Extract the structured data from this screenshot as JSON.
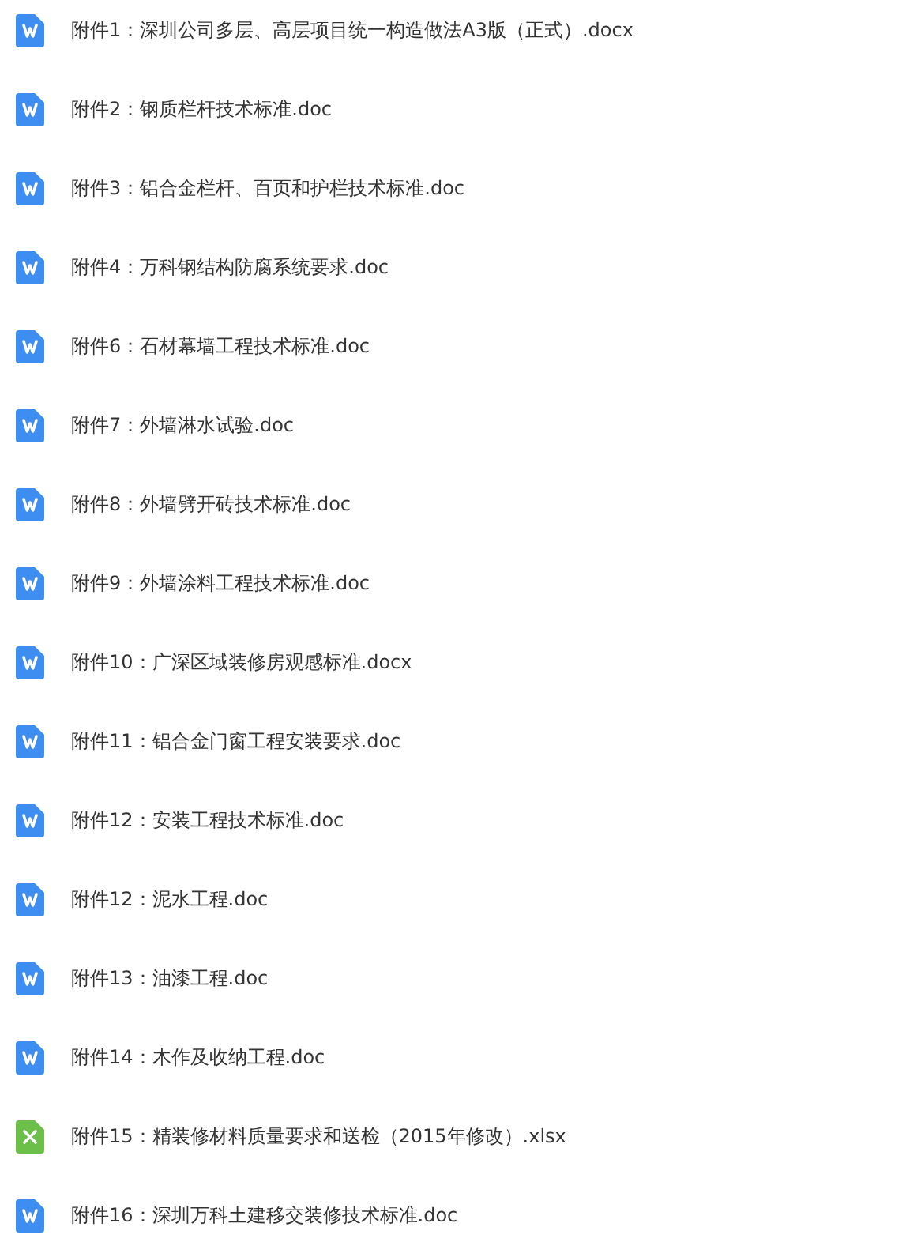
{
  "files": [
    {
      "kind": "word",
      "name": "附件1：深圳公司多层、高层项目统一构造做法A3版（正式）.docx"
    },
    {
      "kind": "word",
      "name": "附件2：钢质栏杆技术标准.doc"
    },
    {
      "kind": "word",
      "name": "附件3：铝合金栏杆、百页和护栏技术标准.doc"
    },
    {
      "kind": "word",
      "name": "附件4：万科钢结构防腐系统要求.doc"
    },
    {
      "kind": "word",
      "name": "附件6：石材幕墙工程技术标准.doc"
    },
    {
      "kind": "word",
      "name": "附件7：外墙淋水试验.doc"
    },
    {
      "kind": "word",
      "name": "附件8：外墙劈开砖技术标准.doc"
    },
    {
      "kind": "word",
      "name": "附件9：外墙涂料工程技术标准.doc"
    },
    {
      "kind": "word",
      "name": "附件10：广深区域装修房观感标准.docx"
    },
    {
      "kind": "word",
      "name": "附件11：铝合金门窗工程安装要求.doc"
    },
    {
      "kind": "word",
      "name": "附件12：安装工程技术标准.doc"
    },
    {
      "kind": "word",
      "name": "附件12：泥水工程.doc"
    },
    {
      "kind": "word",
      "name": "附件13：油漆工程.doc"
    },
    {
      "kind": "word",
      "name": "附件14：木作及收纳工程.doc"
    },
    {
      "kind": "excel",
      "name": "附件15：精装修材料质量要求和送检（2015年修改）.xlsx"
    },
    {
      "kind": "word",
      "name": "附件16：深圳万科土建移交装修技术标准.doc"
    }
  ]
}
